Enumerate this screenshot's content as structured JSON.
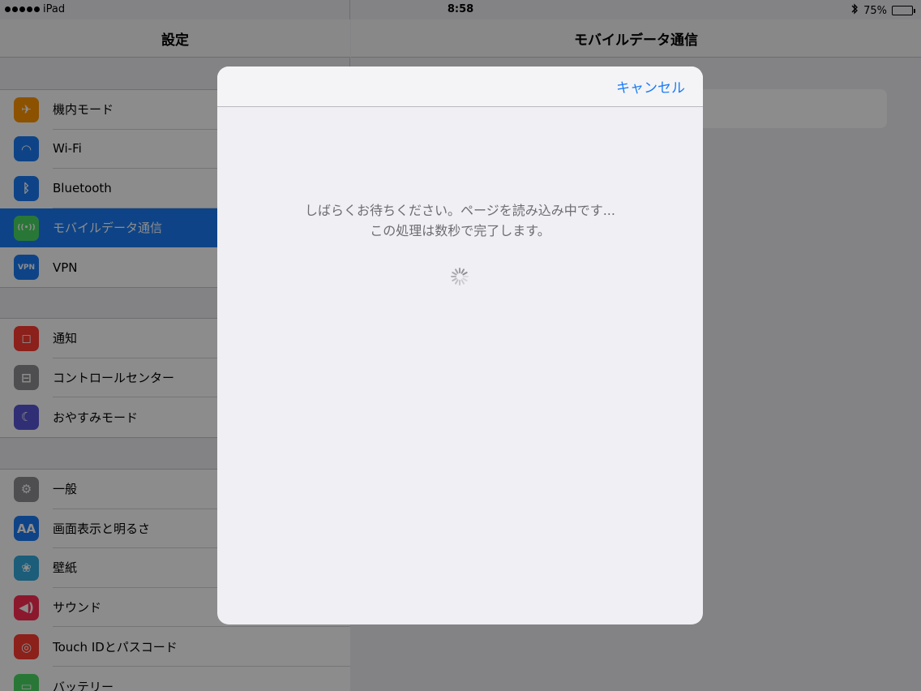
{
  "status_bar": {
    "carrier": "iPad",
    "time": "8:58",
    "battery_percent": "75%",
    "battery_level": 0.75
  },
  "settings_pane": {
    "title": "設定",
    "groups": [
      [
        {
          "label": "機内モード",
          "icon": "airplane-icon",
          "color": "#ff9500"
        },
        {
          "label": "Wi-Fi",
          "icon": "wifi-icon",
          "color": "#1a7cf6"
        },
        {
          "label": "Bluetooth",
          "icon": "bluetooth-icon",
          "color": "#1a7cf6"
        },
        {
          "label": "モバイルデータ通信",
          "icon": "cellular-icon",
          "color": "#4cd964",
          "selected": true
        },
        {
          "label": "VPN",
          "icon": "vpn-icon",
          "color": "#1a7cf6"
        }
      ],
      [
        {
          "label": "通知",
          "icon": "notifications-icon",
          "color": "#ff3b30"
        },
        {
          "label": "コントロールセンター",
          "icon": "control-center-icon",
          "color": "#8e8e93"
        },
        {
          "label": "おやすみモード",
          "icon": "moon-icon",
          "color": "#5856d6"
        }
      ],
      [
        {
          "label": "一般",
          "icon": "gear-icon",
          "color": "#8e8e93"
        },
        {
          "label": "画面表示と明るさ",
          "icon": "display-icon",
          "color": "#1a7cf6"
        },
        {
          "label": "壁紙",
          "icon": "wallpaper-icon",
          "color": "#34aadc"
        },
        {
          "label": "サウンド",
          "icon": "sound-icon",
          "color": "#ff2d55"
        },
        {
          "label": "Touch IDとパスコード",
          "icon": "fingerprint-icon",
          "color": "#ff3b30"
        },
        {
          "label": "バッテリー",
          "icon": "battery-icon",
          "color": "#4cd964"
        }
      ]
    ]
  },
  "detail_pane": {
    "title": "モバイルデータ通信"
  },
  "modal": {
    "cancel_label": "キャンセル",
    "loading_line1": "しばらくお待ちください。ページを読み込み中です...",
    "loading_line2": "この処理は数秒で完了します。"
  }
}
